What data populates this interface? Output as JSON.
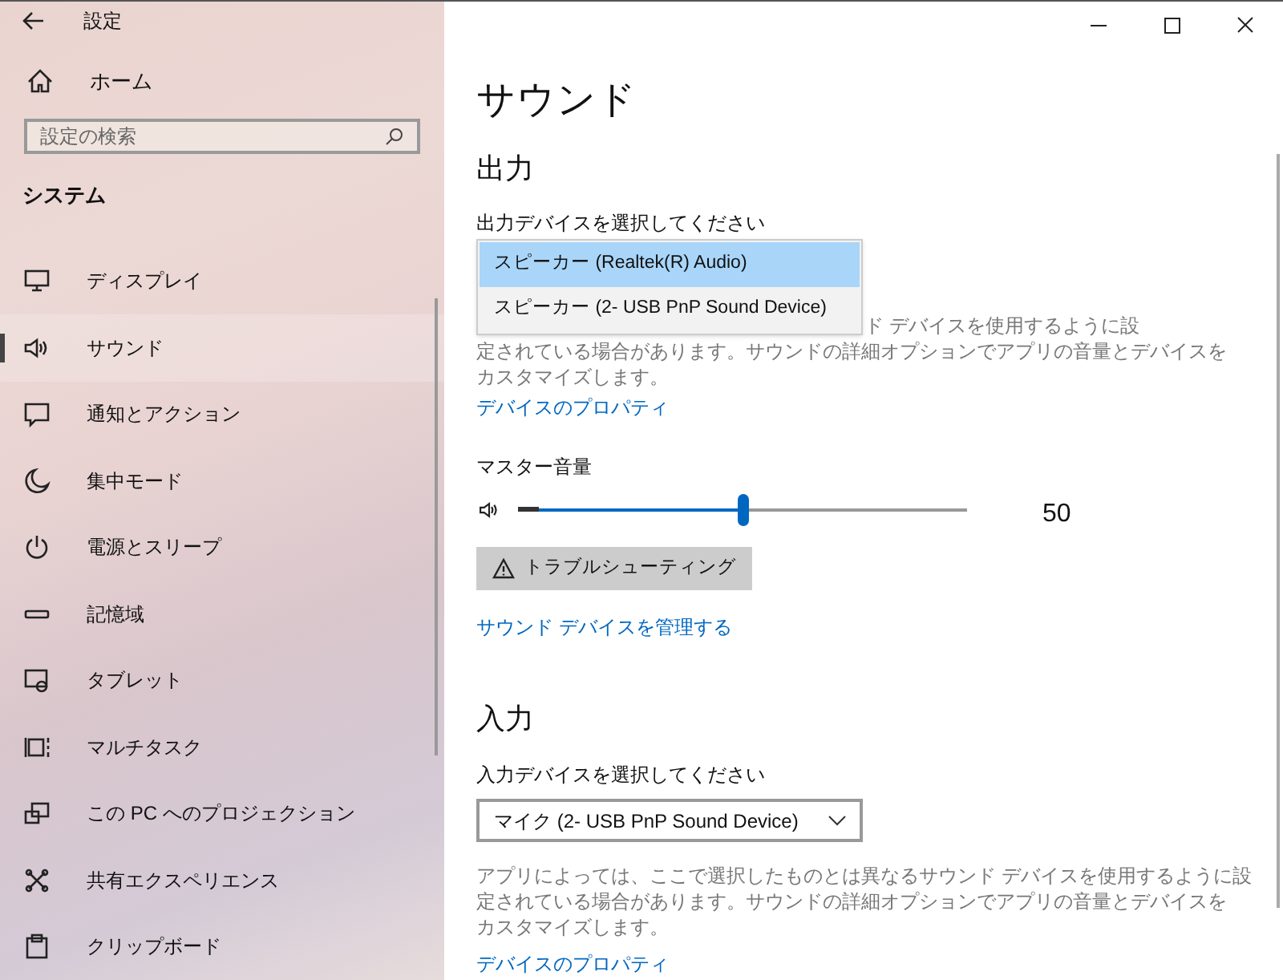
{
  "window": {
    "title": "設定"
  },
  "sidebar": {
    "home": "ホーム",
    "search": {
      "placeholder": "設定の検索"
    },
    "section": "システム",
    "items": [
      {
        "kind": "display",
        "label": "ディスプレイ",
        "selected": false
      },
      {
        "kind": "sound",
        "label": "サウンド",
        "selected": true
      },
      {
        "kind": "notify",
        "label": "通知とアクション",
        "selected": false
      },
      {
        "kind": "focus",
        "label": "集中モード",
        "selected": false
      },
      {
        "kind": "power",
        "label": "電源とスリープ",
        "selected": false
      },
      {
        "kind": "storage",
        "label": "記憶域",
        "selected": false
      },
      {
        "kind": "tablet",
        "label": "タブレット",
        "selected": false
      },
      {
        "kind": "multitask",
        "label": "マルチタスク",
        "selected": false
      },
      {
        "kind": "project",
        "label": "この PC へのプロジェクション",
        "selected": false
      },
      {
        "kind": "share",
        "label": "共有エクスペリエンス",
        "selected": false
      },
      {
        "kind": "clipboard",
        "label": "クリップボード",
        "selected": false
      }
    ]
  },
  "page": {
    "title": "サウンド",
    "output": {
      "heading": "出力",
      "label": "出力デバイスを選択してください",
      "options": [
        {
          "label": "スピーカー (Realtek(R) Audio)",
          "selected": true
        },
        {
          "label": "スピーカー (2- USB PnP Sound Device)",
          "selected": false
        }
      ],
      "description": [
        "ド デバイスを使用するように設",
        "定されている場合があります。サウンドの詳細オプションでアプリの音量とデバイスを",
        "カスタマイズします。"
      ],
      "link": "デバイスのプロパティ",
      "volume_label": "マスター音量",
      "volume": {
        "level": 0.5,
        "reading": "50"
      },
      "troubleshoot": "トラブルシューティング",
      "manage_link": "サウンド デバイスを管理する"
    },
    "input": {
      "heading": "入力",
      "label": "入力デバイスを選択してください",
      "value": "マイク (2- USB PnP Sound Device)",
      "description": [
        "アプリによっては、ここで選択したものとは異なるサウンド デバイスを使用するように設",
        "定されている場合があります。サウンドの詳細オプションでアプリの音量とデバイスを",
        "カスタマイズします。"
      ],
      "link": "デバイスのプロパティ"
    }
  }
}
